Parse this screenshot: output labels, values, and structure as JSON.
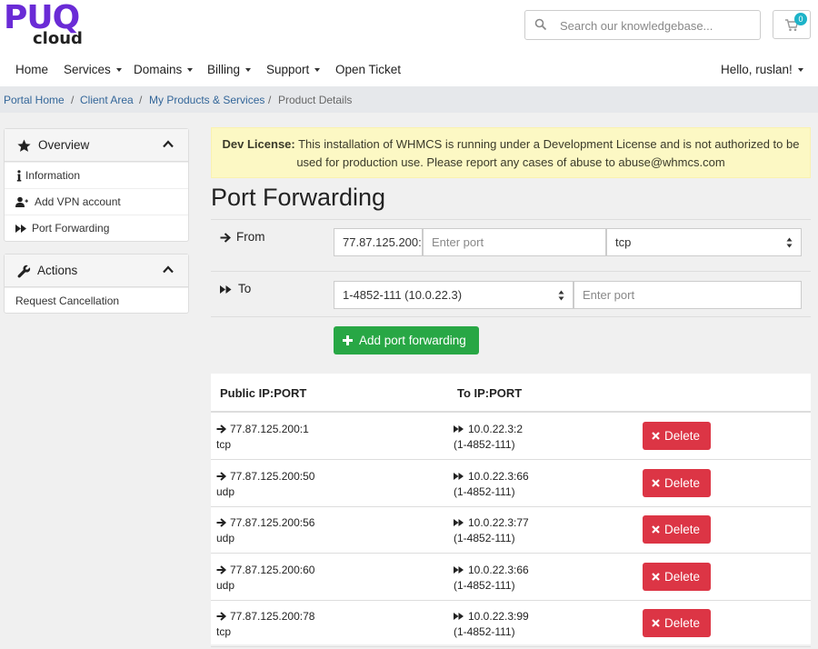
{
  "brand": {
    "logo_top": "PUQ",
    "logo_bottom": "cloud",
    "accent": "#6a2bd6"
  },
  "search": {
    "placeholder": "Search our knowledgebase...",
    "icon": "search-icon"
  },
  "cart": {
    "count": "0",
    "icon": "cart-icon",
    "badge_color": "#1db3c8"
  },
  "nav": {
    "items": [
      {
        "label": "Home",
        "dropdown": false
      },
      {
        "label": "Services",
        "dropdown": true
      },
      {
        "label": "Domains",
        "dropdown": true
      },
      {
        "label": "Billing",
        "dropdown": true
      },
      {
        "label": "Support",
        "dropdown": true
      },
      {
        "label": "Open Ticket",
        "dropdown": false
      }
    ],
    "user": "Hello, ruslan!"
  },
  "breadcrumb": {
    "items": [
      "Portal Home",
      "Client Area",
      "My Products & Services",
      "Product Details"
    ],
    "separator": "/"
  },
  "sidebar": {
    "overview": {
      "title": "Overview",
      "icon": "star-icon",
      "items": [
        {
          "label": "Information",
          "icon": "info-icon"
        },
        {
          "label": "Add VPN account",
          "icon": "user-plus-icon"
        },
        {
          "label": "Port Forwarding",
          "icon": "forward-icon"
        }
      ]
    },
    "actions": {
      "title": "Actions",
      "icon": "wrench-icon",
      "items": [
        {
          "label": "Request Cancellation"
        }
      ]
    }
  },
  "alert": {
    "bold": "Dev License:",
    "text": " This installation of WHMCS is running under a Development License and is not authorized to be used for production use. Please report any cases of abuse to abuse@whmcs.com"
  },
  "page": {
    "title": "Port Forwarding"
  },
  "form": {
    "from": {
      "label": "From",
      "ip_value": "77.87.125.200:",
      "port_placeholder": "Enter port",
      "protocol_selected": "tcp"
    },
    "to": {
      "label": "To",
      "target_selected": "1-4852-111 (10.0.22.3)",
      "port_placeholder": "Enter port"
    },
    "add_button": "Add port forwarding"
  },
  "table": {
    "headers": [
      "Public IP:PORT",
      "To IP:PORT",
      ""
    ],
    "rows": [
      {
        "from": "77.87.125.200:1",
        "proto": "tcp",
        "to": "10.0.22.3:2",
        "account": "(1-4852-111)"
      },
      {
        "from": "77.87.125.200:50",
        "proto": "udp",
        "to": "10.0.22.3:66",
        "account": "(1-4852-111)"
      },
      {
        "from": "77.87.125.200:56",
        "proto": "udp",
        "to": "10.0.22.3:77",
        "account": "(1-4852-111)"
      },
      {
        "from": "77.87.125.200:60",
        "proto": "udp",
        "to": "10.0.22.3:66",
        "account": "(1-4852-111)"
      },
      {
        "from": "77.87.125.200:78",
        "proto": "tcp",
        "to": "10.0.22.3:99",
        "account": "(1-4852-111)"
      }
    ],
    "delete_label": "Delete",
    "delete_color": "#dc3545",
    "add_color": "#28a745"
  }
}
